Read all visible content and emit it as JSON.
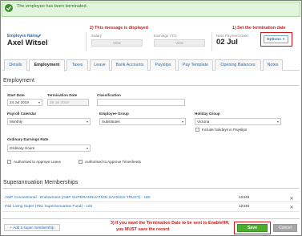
{
  "banner": {
    "message": "The employee has been terminated."
  },
  "annotations": {
    "a1": "1) Set the termination date",
    "a2": "2) This message is displayed",
    "a3_line1": "3) If you want the Termination Date to be sent to EnableHR,",
    "a3_line2": "you MUST save the record"
  },
  "employee": {
    "label": "Employee Name",
    "name": "Axel Witsel"
  },
  "salary": {
    "label": "Salary",
    "button": "View"
  },
  "earnings": {
    "label": "Earnings YTD",
    "button": "View"
  },
  "next_payment": {
    "label": "Next Payment Date",
    "date": "02 Jul"
  },
  "options": {
    "label": "Options"
  },
  "tabs": [
    "Details",
    "Employment",
    "Taxes",
    "Leave",
    "Bank Accounts",
    "Payslips",
    "Pay Template",
    "Opening Balances",
    "Notes"
  ],
  "employment": {
    "title": "Employment",
    "start_date": {
      "label": "Start Date",
      "value": "24 Jul 2019"
    },
    "termination_date": {
      "label": "Termination Date",
      "value": "25 Jul 2019"
    },
    "classification": {
      "label": "Classification",
      "value": ""
    },
    "payroll_calendar": {
      "label": "Payroll Calendar",
      "value": "Monthly"
    },
    "employee_group": {
      "label": "Employee Group",
      "value": "Substitutes"
    },
    "holiday_group": {
      "label": "Holiday Group",
      "value": "Victoria"
    },
    "include_holidays": "Include holidays in Payslips",
    "earnings_rate": {
      "label": "Ordinary Earnings Rate",
      "value": "Ordinary Hours"
    },
    "approve_leave": "Authorised to Approve Leave",
    "approve_timesheets": "Authorised to Approve Timesheets"
  },
  "super": {
    "title": "Superannuation Memberships",
    "rows": [
      {
        "fund": "AMP Conventional - Endowment (AMP SUPERANNUATION SAVINGS TRUST) - USI",
        "number": "12345"
      },
      {
        "fund": "ING Living Super (ING Superannuation Fund) - USI",
        "number": "12345"
      }
    ],
    "add_label": "+ Add a super membership"
  },
  "actions": {
    "save": "Save",
    "cancel": "Cancel"
  },
  "colors": {
    "accent": "#2b6fb0",
    "annotation": "#d01818",
    "save": "#4caf2c",
    "banner": "#e3f4dd"
  }
}
